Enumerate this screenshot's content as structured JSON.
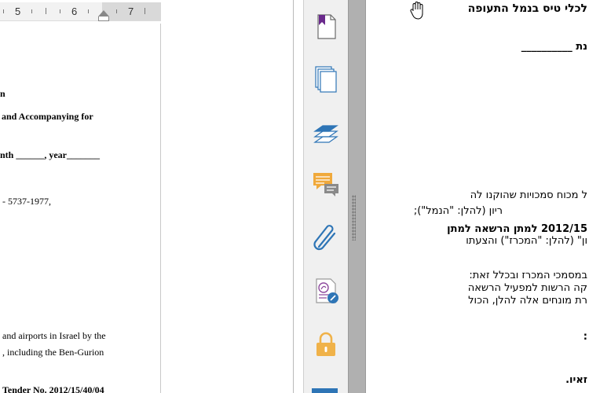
{
  "ruler": {
    "marks": [
      "5",
      "6",
      "7"
    ]
  },
  "document": {
    "lines": [
      "n",
      "and Accompanying for",
      "nth ______, year_______",
      "- 5737-1977,",
      "and airports in Israel by the",
      ", including the Ben-Gurion",
      "Tender No. 2012/15/40/04"
    ]
  },
  "toolbar": {
    "tools": [
      {
        "name": "bookmark-tool",
        "icon": "bookmark-page-icon"
      },
      {
        "name": "pages-tool",
        "icon": "pages-icon"
      },
      {
        "name": "layers-tool",
        "icon": "layers-icon"
      },
      {
        "name": "comments-tool",
        "icon": "comment-icon"
      },
      {
        "name": "attachments-tool",
        "icon": "paperclip-icon"
      },
      {
        "name": "sign-tool",
        "icon": "sign-certificate-icon"
      },
      {
        "name": "security-tool",
        "icon": "lock-icon"
      }
    ],
    "accent": "#2e75b6"
  },
  "pdf": {
    "lines": [
      "לכלי טיס בנמל התעופה",
      "נת __________",
      "ל מכוח סמכויות שהוקנו לה",
      "ריון (להלן: \"הנמל\");",
      "2012/15 למתן הרשאה למתן",
      "ון\" (להלן: \"המכרז\") והצעתו",
      "במסמכי המכרז ובכלל זאת:",
      "קה הרשות למפעיל הרשאה",
      "רת מונחים אלה להלן, הכול",
      ":",
      "זאיו."
    ]
  }
}
